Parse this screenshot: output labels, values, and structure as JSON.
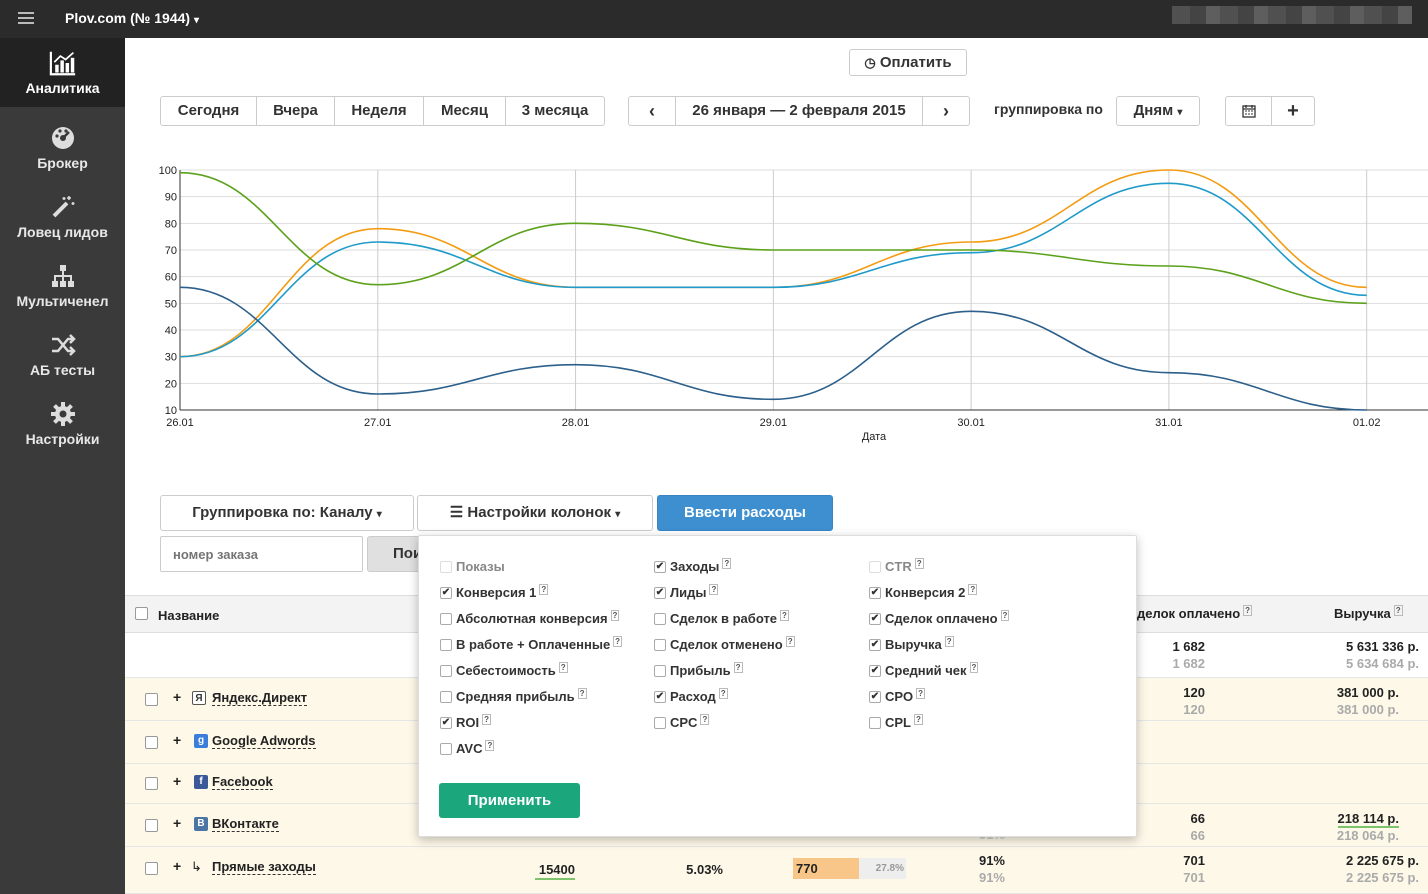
{
  "topbar": {
    "brand": "Plov.com (№ 1944)"
  },
  "sidebar": {
    "items": [
      {
        "label": "Аналитика",
        "icon": "chart-icon",
        "active": true
      },
      {
        "label": "Брокер",
        "icon": "dashboard-icon"
      },
      {
        "label": "Ловец лидов",
        "icon": "magic-wand-icon"
      },
      {
        "label": "Мультиченел",
        "icon": "sitemap-icon"
      },
      {
        "label": "АБ тесты",
        "icon": "shuffle-icon"
      },
      {
        "label": "Настройки",
        "icon": "gear-icon"
      }
    ]
  },
  "pay_button": "Оплатить",
  "periods": [
    "Сегодня",
    "Вчера",
    "Неделя",
    "Месяц",
    "3 месяца"
  ],
  "date_range": "26 января — 2 февраля 2015",
  "grouping_label": "группировка по",
  "grouping_value": "Дням",
  "chart_data": {
    "type": "line",
    "x": [
      "26.01",
      "27.01",
      "28.01",
      "29.01",
      "30.01",
      "31.01",
      "01.02"
    ],
    "xlabel": "Дата",
    "ylim": [
      10,
      100
    ],
    "yticks": [
      "10",
      "20",
      "30",
      "40",
      "50",
      "60",
      "70",
      "80",
      "90",
      "100"
    ],
    "grid": true,
    "series": [
      {
        "color": "#f39c12",
        "values": [
          30,
          78,
          56,
          56,
          73,
          100,
          56
        ]
      },
      {
        "color": "#1f9ac9",
        "values": [
          30,
          73,
          56,
          56,
          69,
          95,
          53
        ]
      },
      {
        "color": "#5ca11a",
        "values": [
          99,
          57,
          80,
          70,
          70,
          64,
          50
        ]
      },
      {
        "color": "#2c5f8a",
        "values": [
          56,
          16,
          27,
          14,
          47,
          24,
          10
        ]
      }
    ]
  },
  "toolbar": {
    "group_by": "Группировка по: Каналу",
    "columns": "Настройки колонок",
    "expenses": "Ввести расходы",
    "order_placeholder": "номер заказа",
    "search_btn": "Пои"
  },
  "table": {
    "headers": {
      "name": "Название",
      "deals_paid": "делок оплачено",
      "revenue": "Выручка"
    },
    "total": {
      "deals": "1 682",
      "deals_sub": "1 682",
      "revenue": "5 631 336 р.",
      "revenue_sub": "5 634 684 р."
    },
    "rows": [
      {
        "name": "Яндекс.Директ",
        "icon": "yandex-icon",
        "deals": "120",
        "deals_sub": "120",
        "revenue": "381 000 р.",
        "revenue_sub": "381 000 р."
      },
      {
        "name": "Google Adwords",
        "icon": "google-icon"
      },
      {
        "name": "Facebook",
        "icon": "facebook-icon"
      },
      {
        "name": "ВКонтакте",
        "icon": "vk-icon",
        "deals": "66",
        "deals_sub": "66",
        "revenue": "218 114 р.",
        "revenue_sub": "218 064 р.",
        "pct_sub": "91%"
      },
      {
        "name": "Прямые заходы",
        "icon": "direct-icon",
        "visits": "15400",
        "conv": "5.03%",
        "leads": "770",
        "leads_pct": "27.8%",
        "leads_fill": 0.58,
        "pct": "91%",
        "pct_sub": "91%",
        "deals": "701",
        "deals_sub": "701",
        "revenue": "2 225 675 р.",
        "revenue_sub": "2 225 675 р."
      }
    ]
  },
  "popup": {
    "apply": "Применить",
    "columns": [
      [
        {
          "label": "Показы",
          "checked": false,
          "disabled": true,
          "help": false
        },
        {
          "label": "Конверсия 1",
          "checked": true,
          "help": true
        },
        {
          "label": "Абсолютная конверсия",
          "checked": false,
          "help": true
        },
        {
          "label": "В работе + Оплаченные",
          "checked": false,
          "help": true
        },
        {
          "label": "Себестоимость",
          "checked": false,
          "help": true
        },
        {
          "label": "Средняя прибыль",
          "checked": false,
          "help": true
        },
        {
          "label": "ROI",
          "checked": true,
          "help": true
        },
        {
          "label": "AVC",
          "checked": false,
          "help": true
        }
      ],
      [
        {
          "label": "Заходы",
          "checked": true,
          "help": true
        },
        {
          "label": "Лиды",
          "checked": true,
          "help": true
        },
        {
          "label": "Сделок в работе",
          "checked": false,
          "help": true
        },
        {
          "label": "Сделок отменено",
          "checked": false,
          "help": true
        },
        {
          "label": "Прибыль",
          "checked": false,
          "help": true
        },
        {
          "label": "Расход",
          "checked": true,
          "help": true
        },
        {
          "label": "CPC",
          "checked": false,
          "help": true
        }
      ],
      [
        {
          "label": "CTR",
          "checked": false,
          "disabled": true,
          "help": true
        },
        {
          "label": "Конверсия 2",
          "checked": true,
          "help": true
        },
        {
          "label": "Сделок оплачено",
          "checked": true,
          "help": true
        },
        {
          "label": "Выручка",
          "checked": true,
          "help": true
        },
        {
          "label": "Средний чек",
          "checked": true,
          "help": true
        },
        {
          "label": "CPO",
          "checked": true,
          "help": true
        },
        {
          "label": "CPL",
          "checked": false,
          "help": true
        }
      ]
    ],
    "help_mark": "?"
  }
}
